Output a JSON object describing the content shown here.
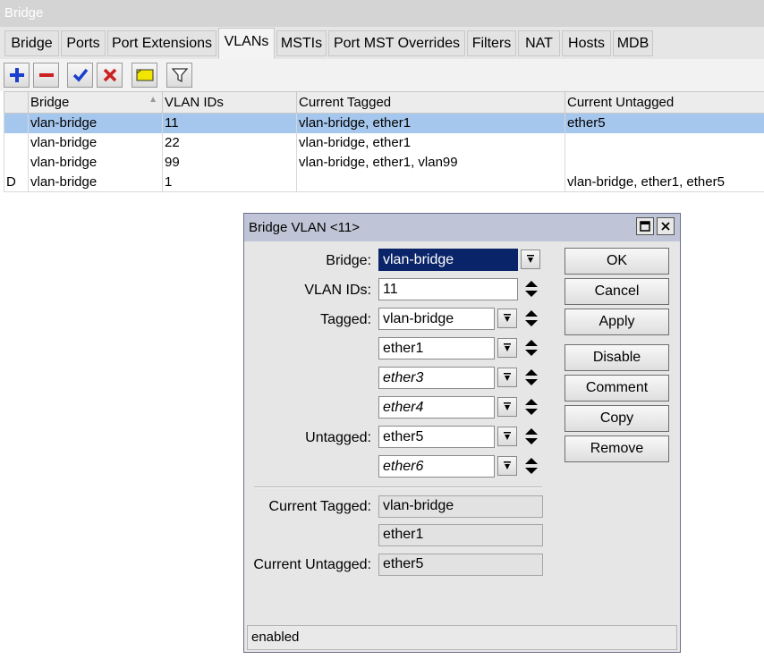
{
  "window": {
    "title": "Bridge"
  },
  "tabs": [
    "Bridge",
    "Ports",
    "Port Extensions",
    "VLANs",
    "MSTIs",
    "Port MST Overrides",
    "Filters",
    "NAT",
    "Hosts",
    "MDB"
  ],
  "active_tab": "VLANs",
  "toolbar": {
    "buttons": [
      "add-icon",
      "remove-icon",
      "enable-icon",
      "disable-icon",
      "comment-icon",
      "filter-icon"
    ],
    "colors": {
      "add": "#1a3fcc",
      "remove": "#cc1f1f",
      "enable": "#1a3fcc",
      "disable": "#cc1f1f",
      "comment": "#f2e600"
    }
  },
  "table": {
    "columns": [
      "",
      "Bridge",
      "VLAN IDs",
      "Current Tagged",
      "Current Untagged"
    ],
    "rows": [
      {
        "flag": "",
        "bridge": "vlan-bridge",
        "vlan_ids": "11",
        "current_tagged": "vlan-bridge, ether1",
        "current_untagged": "ether5"
      },
      {
        "flag": "",
        "bridge": "vlan-bridge",
        "vlan_ids": "22",
        "current_tagged": "vlan-bridge, ether1",
        "current_untagged": ""
      },
      {
        "flag": "",
        "bridge": "vlan-bridge",
        "vlan_ids": "99",
        "current_tagged": "vlan-bridge, ether1, vlan99",
        "current_untagged": ""
      },
      {
        "flag": "D",
        "bridge": "vlan-bridge",
        "vlan_ids": "1",
        "current_tagged": "",
        "current_untagged": "vlan-bridge, ether1, ether5"
      }
    ]
  },
  "dialog": {
    "title": "Bridge VLAN <11>",
    "labels": {
      "bridge": "Bridge:",
      "vlan_ids": "VLAN IDs:",
      "tagged": "Tagged:",
      "untagged": "Untagged:",
      "current_tagged": "Current Tagged:",
      "current_untagged": "Current Untagged:"
    },
    "bridge": "vlan-bridge",
    "vlan_ids": "11",
    "tagged": [
      "vlan-bridge",
      "ether1",
      "ether3",
      "ether4"
    ],
    "untagged": [
      "ether5",
      "ether6"
    ],
    "current_tagged": [
      "vlan-bridge",
      "ether1"
    ],
    "current_untagged": "ether5",
    "buttons": {
      "ok": "OK",
      "cancel": "Cancel",
      "apply": "Apply",
      "disable": "Disable",
      "comment": "Comment",
      "copy": "Copy",
      "remove": "Remove"
    },
    "status": "enabled"
  }
}
